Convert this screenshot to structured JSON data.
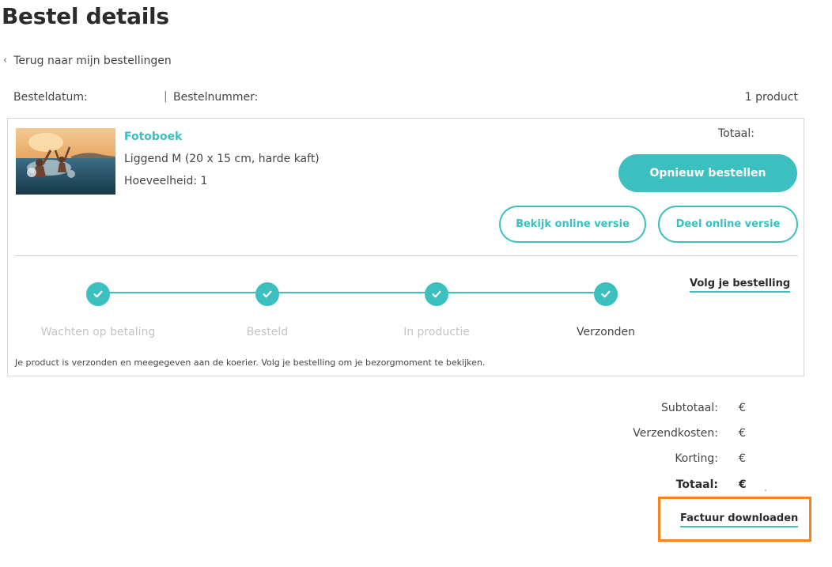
{
  "page": {
    "title": "Bestel details"
  },
  "back": {
    "label": "Terug naar mijn bestellingen"
  },
  "meta": {
    "date_label": "Besteldatum:",
    "number_label": "Bestelnummer:",
    "count": "1 product"
  },
  "product": {
    "name": "Fotoboek",
    "variant": "Liggend M (20 x 15 cm, harde kaft)",
    "quantity": "Hoeveelheid: 1",
    "total_label": "Totaal:"
  },
  "actions": {
    "reorder": "Opnieuw bestellen",
    "view_online": "Bekijk online versie",
    "share_online": "Deel online versie",
    "track": "Volg je bestelling"
  },
  "steps": [
    {
      "label": "Wachten op betaling",
      "done": true,
      "active": false
    },
    {
      "label": "Besteld",
      "done": true,
      "active": false
    },
    {
      "label": "In productie",
      "done": true,
      "active": false
    },
    {
      "label": "Verzonden",
      "done": true,
      "active": true
    }
  ],
  "status_message": "Je product is verzonden en meegegeven aan de koerier. Volg je bestelling om je bezorgmoment te bekijken.",
  "summary": [
    {
      "label": "Subtotaal:",
      "currency": "€"
    },
    {
      "label": "Verzendkosten:",
      "currency": "€"
    },
    {
      "label": "Korting:",
      "currency": "€"
    },
    {
      "label": "Totaal:",
      "currency": "€"
    }
  ],
  "invoice": {
    "label": "Factuur downloaden"
  },
  "colors": {
    "accent": "#3bbfbf",
    "highlight": "#f4841f",
    "inactive_step": "#c4c4c4"
  }
}
